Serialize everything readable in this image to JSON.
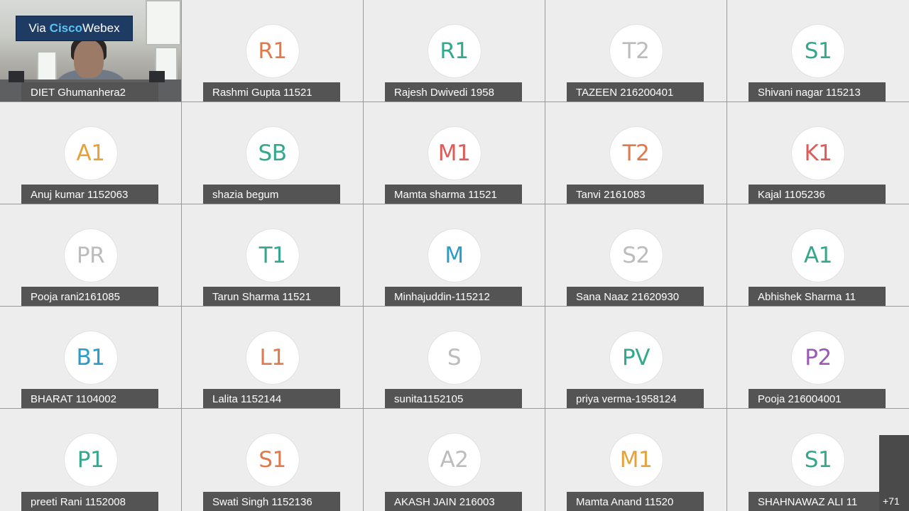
{
  "app": {
    "badge_prefix": "Via",
    "badge_brand_1": "Cisco",
    "badge_brand_2": "Webex"
  },
  "video_tile": {
    "name": "DIET Ghumanhera2"
  },
  "participants": [
    {
      "initials": "R1",
      "name": "Rashmi Gupta 11521",
      "color": "#e07a4a"
    },
    {
      "initials": "R1",
      "name": "Rajesh Dwivedi 1958",
      "color": "#33a88a"
    },
    {
      "initials": "T2",
      "name": "TAZEEN 216200401",
      "color": "#bcbcbc"
    },
    {
      "initials": "S1",
      "name": "Shivani nagar 115213",
      "color": "#33a88a"
    },
    {
      "initials": "A1",
      "name": "Anuj kumar 1152063",
      "color": "#e6a23a"
    },
    {
      "initials": "SB",
      "name": "shazia begum",
      "color": "#33a88a"
    },
    {
      "initials": "M1",
      "name": "Mamta sharma 11521",
      "color": "#e05a58"
    },
    {
      "initials": "T2",
      "name": "Tanvi 2161083",
      "color": "#e07a4a"
    },
    {
      "initials": "K1",
      "name": "Kajal 1105236",
      "color": "#e05a58"
    },
    {
      "initials": "PR",
      "name": "Pooja rani2161085",
      "color": "#bcbcbc"
    },
    {
      "initials": "T1",
      "name": "Tarun Sharma 11521",
      "color": "#33a88a"
    },
    {
      "initials": "M",
      "name": "Minhajuddin-115212",
      "color": "#2a9cc8"
    },
    {
      "initials": "S2",
      "name": "Sana Naaz 21620930",
      "color": "#bcbcbc"
    },
    {
      "initials": "A1",
      "name": "Abhishek Sharma 11",
      "color": "#33a88a"
    },
    {
      "initials": "B1",
      "name": "BHARAT 1104002",
      "color": "#2a9cc8"
    },
    {
      "initials": "L1",
      "name": "Lalita 1152144",
      "color": "#e07a4a"
    },
    {
      "initials": "S",
      "name": "sunita1152105",
      "color": "#bcbcbc"
    },
    {
      "initials": "PV",
      "name": "priya verma-1958124",
      "color": "#33a88a"
    },
    {
      "initials": "P2",
      "name": "Pooja 216004001",
      "color": "#9b59b6"
    },
    {
      "initials": "P1",
      "name": "preeti Rani 1152008",
      "color": "#33a88a"
    },
    {
      "initials": "S1",
      "name": "Swati Singh 1152136",
      "color": "#e07a4a"
    },
    {
      "initials": "A2",
      "name": "AKASH JAIN 216003",
      "color": "#bcbcbc"
    },
    {
      "initials": "M1",
      "name": "Mamta Anand 11520",
      "color": "#e6a23a"
    },
    {
      "initials": "S1",
      "name": "SHAHNAWAZ ALI 11",
      "color": "#33a88a"
    }
  ],
  "overflow": {
    "label": "+71"
  }
}
